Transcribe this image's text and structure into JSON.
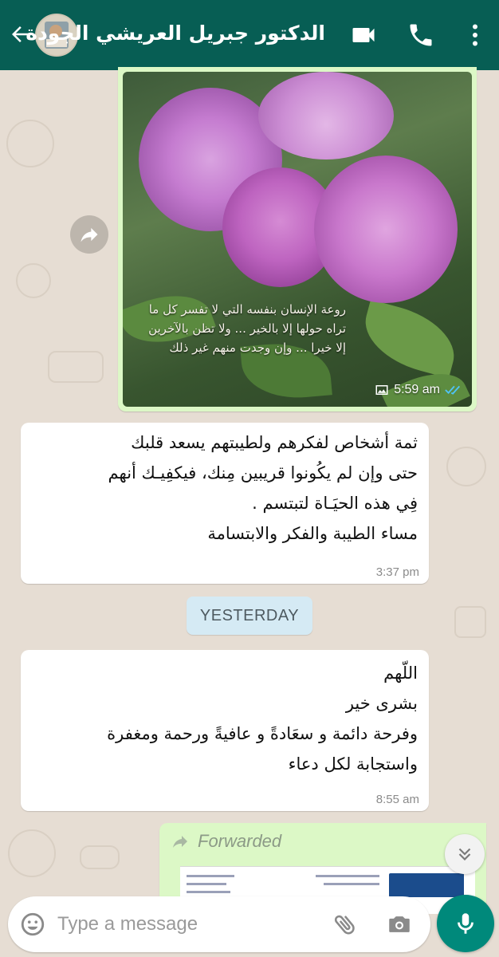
{
  "header": {
    "title": "الدكتور جبريل العريشي الجودة",
    "back_icon": "arrow-left-icon",
    "video_icon": "video-call-icon",
    "call_icon": "phone-icon",
    "menu_icon": "more-vertical-icon",
    "color": "#075e54"
  },
  "messages": {
    "image_message": {
      "caption": "روعة الإنسان بنفسه\nالتي لا تفسر كل ما تراه حولها إلا بالخير ...\nولا تظن بالآخرين إلا خيرا ...\nوإن وجدت منهم غير ذلك",
      "time": "5:59 am",
      "status": "read",
      "forward_icon": "forward-icon"
    },
    "text_message_1": {
      "text": "ثمة أشخاص لفكرهم ولطيبتهم يسعد قلبك\nحتى وإن لم يكُونوا قريبين مِنك، فيكفِيـك أنهم\nفِي هذه الحيَـاة لتبتسم .\nمساء الطيبة والفكر والابتسامة",
      "time": "3:37 pm"
    },
    "date_separator": "YESTERDAY",
    "text_message_2": {
      "text": "اللّهم\nبشرى خير\nوفرحة دائمة و سعَادةً و عافيةً ورحمة ومغفرة\nواستجابة لكل دعاء",
      "time": "8:55 am"
    },
    "forwarded_message": {
      "label": "Forwarded",
      "icon": "forward-arrow-icon"
    }
  },
  "input": {
    "placeholder": "Type a message",
    "emoji_icon": "emoji-icon",
    "attach_icon": "paperclip-icon",
    "camera_icon": "camera-icon",
    "mic_icon": "mic-icon"
  },
  "colors": {
    "accent": "#00897b",
    "outgoing_bubble": "#dcf8c6",
    "incoming_bubble": "#ffffff",
    "read_ticks": "#4fc3f7"
  }
}
